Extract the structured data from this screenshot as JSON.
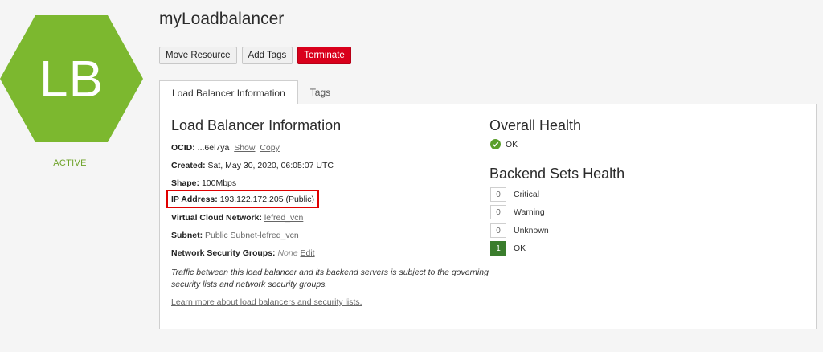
{
  "badge": {
    "initials": "LB",
    "status": "ACTIVE",
    "color": "#7cb82f"
  },
  "header": {
    "title": "myLoadbalancer"
  },
  "actions": {
    "move": "Move Resource",
    "add_tags": "Add Tags",
    "terminate": "Terminate"
  },
  "tabs": [
    {
      "label": "Load Balancer Information"
    },
    {
      "label": "Tags"
    }
  ],
  "info": {
    "title": "Load Balancer Information",
    "ocid_label": "OCID:",
    "ocid_value": "...6el7ya",
    "ocid_show": "Show",
    "ocid_copy": "Copy",
    "created_label": "Created:",
    "created_value": "Sat, May 30, 2020, 06:05:07 UTC",
    "shape_label": "Shape:",
    "shape_value": "100Mbps",
    "ip_label": "IP Address:",
    "ip_value": "193.122.172.205 (Public)",
    "vcn_label": "Virtual Cloud Network:",
    "vcn_value": "lefred_vcn",
    "subnet_label": "Subnet:",
    "subnet_value": "Public Subnet-lefred_vcn",
    "nsg_label": "Network Security Groups:",
    "nsg_value": "None",
    "nsg_edit": "Edit",
    "note": "Traffic between this load balancer and its backend servers is subject to the governing security lists and network security groups.",
    "learn_more": "Learn more about load balancers and security lists."
  },
  "health": {
    "title": "Overall Health",
    "status": "OK",
    "backend_title": "Backend Sets Health",
    "backend": [
      {
        "count": "0",
        "label": "Critical"
      },
      {
        "count": "0",
        "label": "Warning"
      },
      {
        "count": "0",
        "label": "Unknown"
      },
      {
        "count": "1",
        "label": "OK"
      }
    ]
  }
}
